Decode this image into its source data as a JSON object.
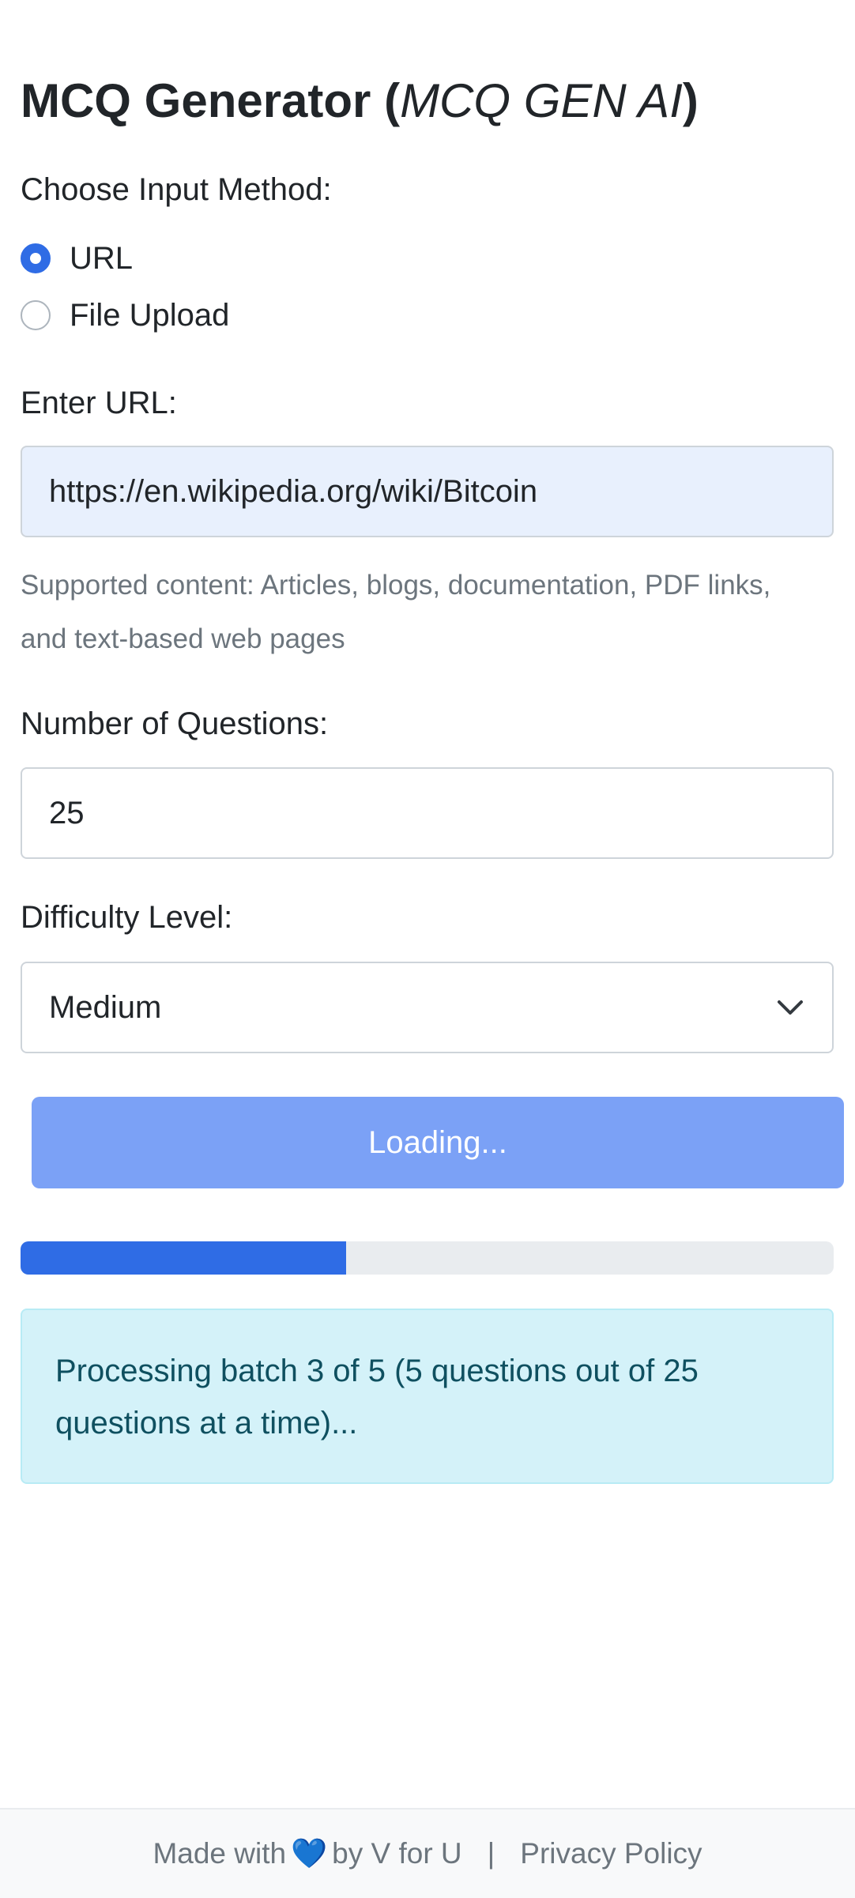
{
  "header": {
    "title_main": "MCQ Generator (",
    "title_italic": "MCQ GEN AI",
    "title_close": ")"
  },
  "input_method": {
    "label": "Choose Input Method:",
    "options": [
      {
        "label": "URL",
        "checked": true
      },
      {
        "label": "File Upload",
        "checked": false
      }
    ]
  },
  "url": {
    "label": "Enter URL:",
    "value": "https://en.wikipedia.org/wiki/Bitcoin",
    "help": "Supported content: Articles, blogs, documentation, PDF links, and text-based web pages"
  },
  "questions": {
    "label": "Number of Questions:",
    "value": "25"
  },
  "difficulty": {
    "label": "Difficulty Level:",
    "selected": "Medium"
  },
  "submit": {
    "label": "Loading..."
  },
  "progress": {
    "fraction": 0.4
  },
  "status": {
    "message": "Processing batch 3 of 5 (5 questions out of 25 questions at a time)..."
  },
  "footer": {
    "made_with": "Made with",
    "heart": "💙",
    "by": "by V for U",
    "separator": "|",
    "privacy": "Privacy Policy"
  },
  "colors": {
    "accent": "#2f6ce5",
    "button_disabled": "#7ba1f6",
    "alert_bg": "#d4f2f9"
  }
}
